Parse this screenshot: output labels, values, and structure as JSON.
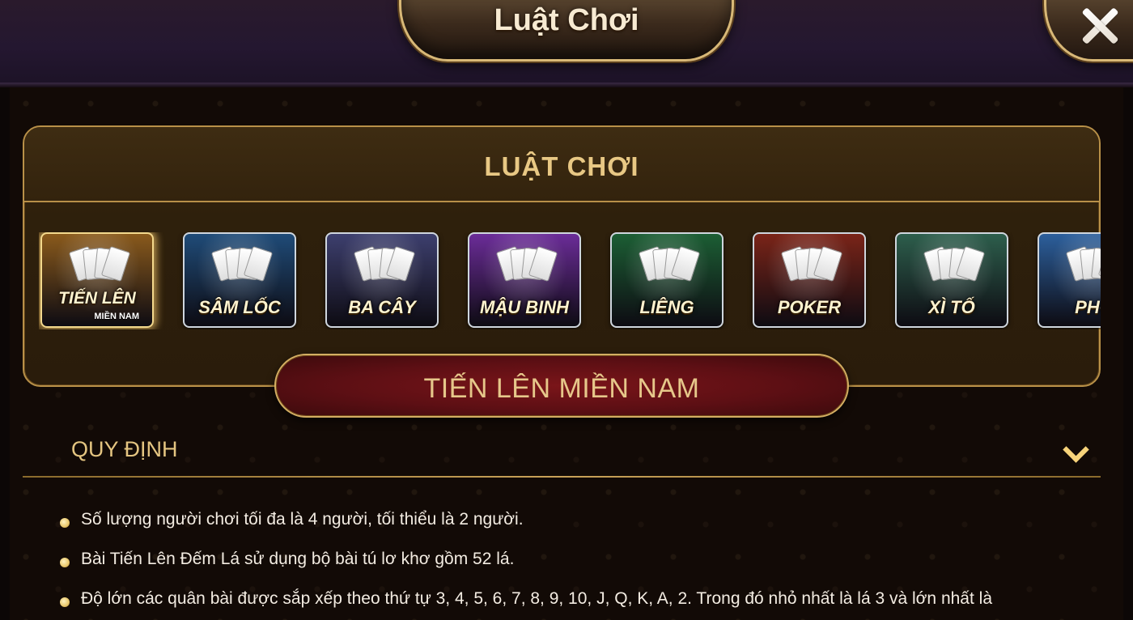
{
  "window": {
    "title": "Luật Chơi",
    "close_icon": "close-icon"
  },
  "rules_panel": {
    "heading": "LUẬT CHƠI",
    "games": [
      {
        "label": "TIẾN LÊN",
        "sub": "MIỀN NAM",
        "selected": true,
        "color": "#8a5a1c"
      },
      {
        "label": "SÂM LỐC",
        "sub": "",
        "selected": false,
        "color": "#1f4b78"
      },
      {
        "label": "BA CÂY",
        "sub": "",
        "selected": false,
        "color": "#3d3f6e"
      },
      {
        "label": "MẬU BINH",
        "sub": "",
        "selected": false,
        "color": "#6b2c98"
      },
      {
        "label": "LIÊNG",
        "sub": "",
        "selected": false,
        "color": "#1c5e34"
      },
      {
        "label": "POKER",
        "sub": "",
        "selected": false,
        "color": "#7a2418"
      },
      {
        "label": "XÌ TỐ",
        "sub": "",
        "selected": false,
        "color": "#2d5e4c"
      },
      {
        "label": "PHỎ",
        "sub": "",
        "selected": false,
        "color": "#2c5f9c"
      }
    ]
  },
  "selected_game": {
    "title": "TIẾN LÊN MIỀN NAM"
  },
  "section": {
    "title": "QUY ĐỊNH",
    "toggle_icon": "chevron-down-icon"
  },
  "rules": [
    "Số lượng người chơi tối đa là 4 người, tối thiểu là 2 người.",
    "Bài Tiến Lên Đếm Lá sử dụng bộ bài tú lơ khơ gồm 52 lá.",
    "Độ lớn các quân bài được sắp xếp theo thứ tự 3, 4, 5, 6, 7, 8, 9, 10, J, Q, K, A, 2. Trong đó nhỏ nhất là lá 3 và lớn nhất là"
  ],
  "colors": {
    "accent_gold": "#e8c884",
    "banner_red": "#5d0f14",
    "text": "#f3ece2"
  }
}
